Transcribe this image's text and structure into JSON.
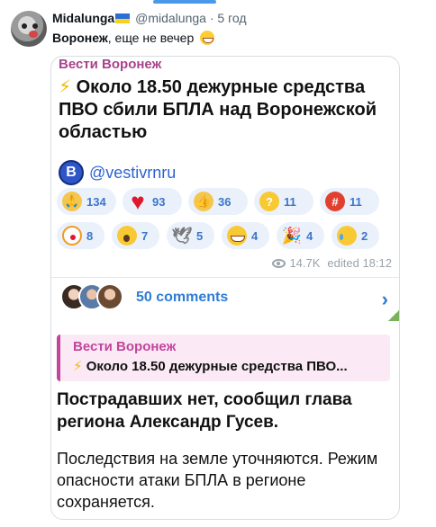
{
  "tweet": {
    "display_name": "Midalunga",
    "handle": "@midalunga",
    "separator": "·",
    "time": "5 год",
    "text_bold": "Воронеж",
    "text_rest": ", еще не вечер",
    "flag_icon": "ukraine-flag-icon",
    "emoji": "grinning-face-icon"
  },
  "post": {
    "channel_title": "Вести Воронеж",
    "headline": "Около 18.50 дежурные средства ПВО сбили БПЛА над Воронежской областью",
    "channel_link": "@vestivrnru",
    "channel_icon_letter": "B",
    "reactions_row1": [
      {
        "icon": "pray-icon",
        "count": "134"
      },
      {
        "icon": "heart-icon",
        "count": "93"
      },
      {
        "icon": "thumbs-up-icon",
        "count": "36"
      },
      {
        "icon": "thinking-icon",
        "count": "11"
      },
      {
        "icon": "angry-icon",
        "count": "11"
      }
    ],
    "reactions_row2": [
      {
        "icon": "clown-icon",
        "count": "8"
      },
      {
        "icon": "scream-icon",
        "count": "7"
      },
      {
        "icon": "dove-icon",
        "count": "5"
      },
      {
        "icon": "grin-icon",
        "count": "4"
      },
      {
        "icon": "party-icon",
        "count": "4"
      },
      {
        "icon": "cry-icon",
        "count": "2"
      }
    ],
    "views": "14.7K",
    "edited": "edited 18:12",
    "comments": "50 comments"
  },
  "reply": {
    "quote_title": "Вести Воронеж",
    "quote_text": "Около 18.50 дежурные средства ПВО...",
    "bold_text": "Пострадавших нет, сообщил глава региона Александр Гусев.",
    "body_text": "Последствия на земле уточняются. Режим опасности атаки БПЛА в регионе сохраняется."
  },
  "colors": {
    "channel_accent": "#a8438c",
    "link_blue": "#2d63d2",
    "reaction_bg": "#eaf1fb"
  }
}
